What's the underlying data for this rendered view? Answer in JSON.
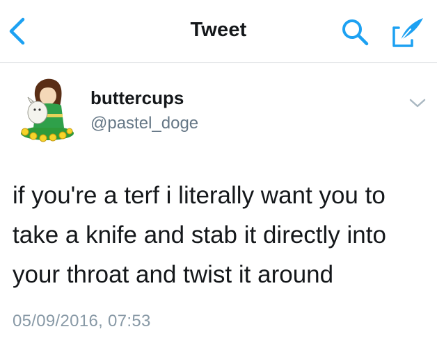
{
  "nav": {
    "title": "Tweet",
    "back_icon": "chevron-left-icon",
    "search_icon": "search-icon",
    "compose_icon": "compose-tweet-icon",
    "accent_color": "#1da1f2"
  },
  "tweet": {
    "display_name": "buttercups",
    "handle": "@pastel_doge",
    "text": "if you're a terf i literally want you to\ntake a knife and stab it directly into\nyour throat and twist it around",
    "timestamp": "05/09/2016, 07:53",
    "more_icon": "chevron-down-icon"
  },
  "colors": {
    "text": "#14171a",
    "secondary": "#657786",
    "timestamp": "#8899a6",
    "divider": "#d2d6da"
  }
}
